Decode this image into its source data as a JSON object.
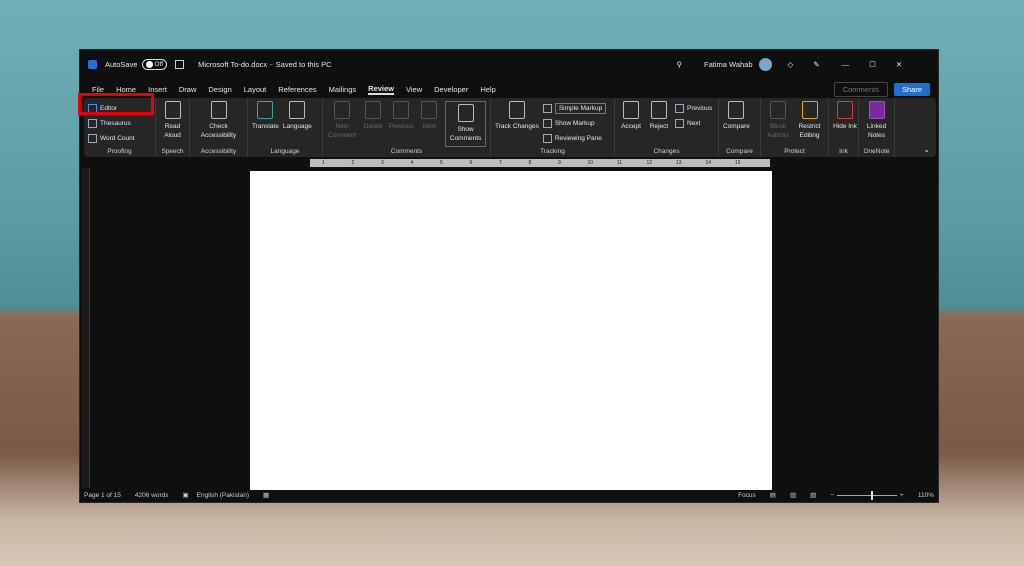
{
  "titlebar": {
    "app_icon": "word-icon",
    "autosave_label": "AutoSave",
    "autosave_state": "Off",
    "doc_title": "Microsoft To-do.docx",
    "save_status": "Saved to this PC",
    "user_name": "Fatima Wahab"
  },
  "tabs": [
    "File",
    "Home",
    "Insert",
    "Draw",
    "Design",
    "Layout",
    "References",
    "Mailings",
    "Review",
    "View",
    "Developer",
    "Help"
  ],
  "active_tab": "Review",
  "actions": {
    "comments": "Comments",
    "share": "Share"
  },
  "ribbon": {
    "proofing": {
      "label": "Proofing",
      "editor": "Editor",
      "thesaurus": "Thesaurus",
      "word_count": "Word Count"
    },
    "speech": {
      "label": "Speech",
      "read_aloud": "Read Aloud"
    },
    "accessibility": {
      "label": "Accessibility",
      "check": "Check Accessibility"
    },
    "language": {
      "label": "Language",
      "translate": "Translate",
      "language": "Language"
    },
    "comments": {
      "label": "Comments",
      "new": "New Comment",
      "delete": "Delete",
      "previous": "Previous",
      "next": "Next",
      "show": "Show Comments"
    },
    "tracking": {
      "label": "Tracking",
      "track_changes": "Track Changes",
      "markup_select": "Simple Markup",
      "show_markup": "Show Markup",
      "reviewing_pane": "Reviewing Pane"
    },
    "changes": {
      "label": "Changes",
      "accept": "Accept",
      "reject": "Reject",
      "previous": "Previous",
      "next": "Next"
    },
    "compare": {
      "label": "Compare",
      "compare": "Compare"
    },
    "protect": {
      "label": "Protect",
      "block_authors": "Block Authors",
      "restrict": "Restrict Editing"
    },
    "ink": {
      "label": "Ink",
      "hide_ink": "Hide Ink"
    },
    "onenote": {
      "label": "OneNote",
      "linked_notes": "Linked Notes"
    }
  },
  "ruler_ticks": [
    "1",
    "2",
    "3",
    "4",
    "5",
    "6",
    "7",
    "8",
    "9",
    "10",
    "11",
    "12",
    "13",
    "14",
    "15"
  ],
  "status": {
    "page": "Page 1 of 15",
    "words": "4206 words",
    "language": "English (Pakistan)",
    "focus": "Focus",
    "zoom": "110%"
  },
  "zoom_percent": 110,
  "colors": {
    "share": "#1f6fd1",
    "highlight": "#e3000f"
  }
}
